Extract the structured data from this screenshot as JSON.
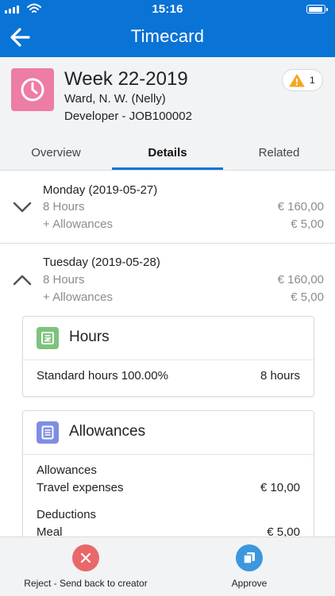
{
  "status_bar": {
    "time": "15:16"
  },
  "nav": {
    "title": "Timecard"
  },
  "record": {
    "title": "Week 22-2019",
    "person": "Ward, N. W. (Nelly)",
    "assignment": "Developer - JOB100002",
    "warning_count": "1"
  },
  "tabs": [
    {
      "label": "Overview",
      "active": false
    },
    {
      "label": "Details",
      "active": true
    },
    {
      "label": "Related",
      "active": false
    }
  ],
  "days": [
    {
      "title": "Monday (2019-05-27)",
      "hours_label": "8 Hours",
      "hours_amount": "€ 160,00",
      "allowance_label": "+ Allowances",
      "allowance_amount": "€ 5,00",
      "expanded": false
    },
    {
      "title": "Tuesday (2019-05-28)",
      "hours_label": "8 Hours",
      "hours_amount": "€ 160,00",
      "allowance_label": "+ Allowances",
      "allowance_amount": "€ 5,00",
      "expanded": true
    }
  ],
  "hours_card": {
    "title": "Hours",
    "row_label": "Standard hours 100.00%",
    "row_value": "8 hours"
  },
  "allowances_card": {
    "title": "Allowances",
    "section1_title": "Allowances",
    "item1_label": "Travel expenses",
    "item1_value": "€ 10,00",
    "section2_title": "Deductions",
    "item2_label": "Meal",
    "item2_value": "€ 5,00"
  },
  "actions": {
    "reject_label": "Reject - Send back to creator",
    "approve_label": "Approve"
  },
  "colors": {
    "brand": "#0A73D6",
    "record_icon": "#ED7CA6",
    "hours_icon": "#7DC37D",
    "allowances_icon": "#7F8DE1",
    "reject": "#E9686A",
    "approve": "#3C97DD",
    "warning": "#F5A623"
  },
  "icons": {
    "back": "arrow-left-icon",
    "record": "clock-icon",
    "warning": "warning-triangle-icon",
    "collapsed": "chevron-down-icon",
    "expanded": "chevron-up-icon",
    "hours_card": "timesheet-icon",
    "allowances_card": "list-icon",
    "reject": "close-icon",
    "approve": "approve-icon"
  }
}
